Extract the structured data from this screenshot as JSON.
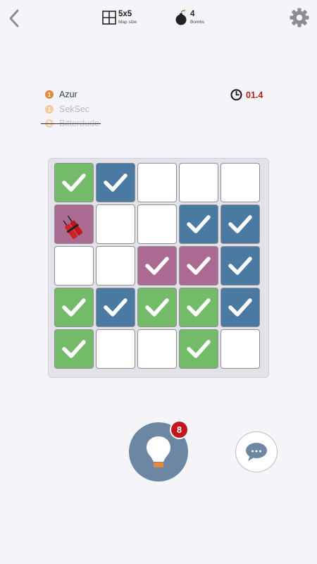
{
  "header": {
    "back_icon": "chevron-left-icon",
    "settings_icon": "gear-icon",
    "map_size": {
      "icon": "grid-icon",
      "value": "5x5",
      "label": "Map size"
    },
    "bombs": {
      "icon": "bomb-icon",
      "value": "4",
      "label": "Bombs"
    }
  },
  "players": [
    {
      "rank": "1",
      "name": "Azur",
      "eliminated": false
    },
    {
      "rank": "1",
      "name": "SekSec",
      "eliminated": false
    },
    {
      "rank": "2",
      "name": "Bitterdude",
      "eliminated": true
    }
  ],
  "timer": {
    "icon": "clock-icon",
    "value": "01.4"
  },
  "board": {
    "rows": 5,
    "cols": 5,
    "cells": [
      [
        "green",
        "blue",
        "empty",
        "empty",
        "empty"
      ],
      [
        "purple-dynamite",
        "empty",
        "empty",
        "blue",
        "blue"
      ],
      [
        "empty",
        "empty",
        "purple",
        "purple",
        "blue"
      ],
      [
        "green",
        "blue",
        "green",
        "green",
        "blue"
      ],
      [
        "green",
        "empty",
        "empty",
        "green",
        "empty"
      ]
    ]
  },
  "hint": {
    "icon": "lightbulb-icon",
    "count": "8"
  },
  "chat": {
    "icon": "chat-bubble-icon"
  },
  "colors": {
    "green": "#73ba69",
    "blue": "#4a7aa1",
    "purple": "#ab6a92",
    "empty": "#ffffff",
    "accent_orange": "#e5893b",
    "timer_red": "#b52018",
    "badge_red": "#c1181f",
    "hint_button": "#6d87a3"
  }
}
